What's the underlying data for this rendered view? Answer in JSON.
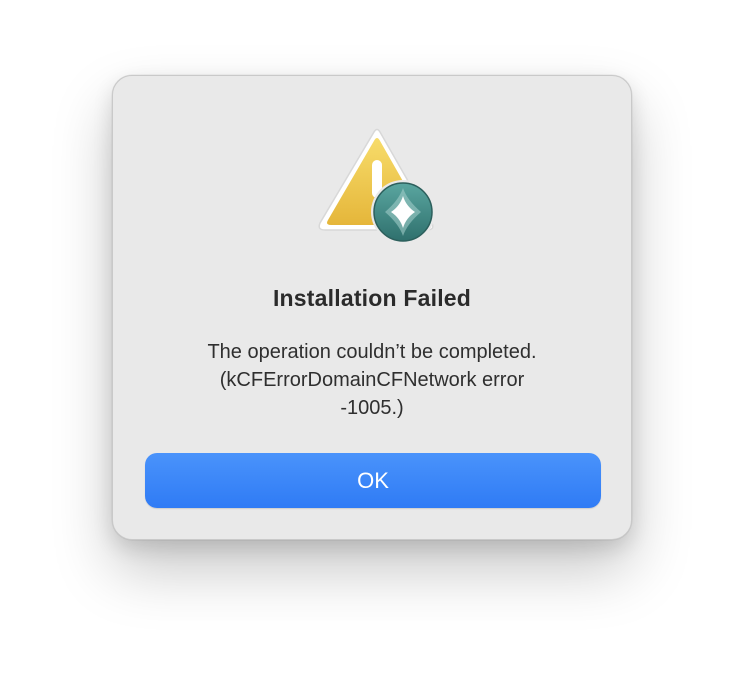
{
  "dialog": {
    "title": "Installation Failed",
    "message": "The operation couldn’t be completed.\n(kCFErrorDomainCFNetwork error\n-1005.)",
    "ok_label": "OK",
    "icon": "warning-triangle-icon",
    "badge_icon": "app-badge-icon"
  },
  "colors": {
    "dialog_background": "#e9e9e9",
    "button_accent": "#3b84f8",
    "warning_yellow": "#f2c94c",
    "badge_teal": "#3f8a86"
  }
}
